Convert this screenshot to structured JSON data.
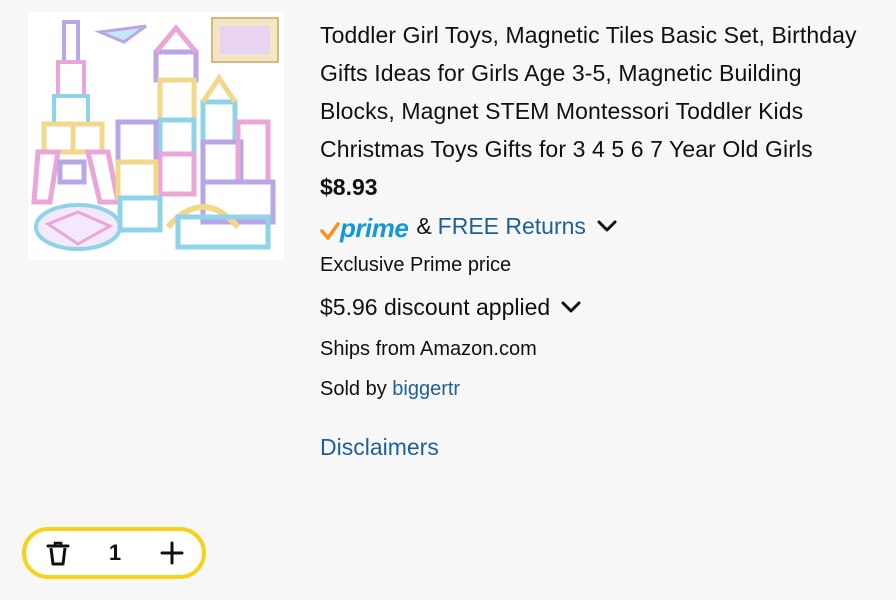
{
  "product": {
    "title": "Toddler Girl Toys, Magnetic Tiles Basic Set, Birthday Gifts Ideas for Girls Age 3-5, Magnetic Building Blocks, Magnet STEM Montessori Toddler Kids Christmas Toys Gifts for 3 4 5 6 7 Year Old Girls",
    "price": "$8.93",
    "prime_label": "prime",
    "amp": "&",
    "free_returns": "FREE Returns",
    "exclusive": "Exclusive Prime price",
    "discount": "$5.96 discount applied",
    "ships_from": "Ships from Amazon.com",
    "sold_by_prefix": "Sold by ",
    "seller": "biggertr",
    "disclaimers": "Disclaimers"
  },
  "quantity": {
    "value": "1"
  },
  "colors": {
    "link": "#1f5f99",
    "prime_blue": "#1399d6",
    "prime_check": "#ff8f1c",
    "highlight_border": "#f5d21b"
  },
  "icons": {
    "delete": "trash-icon",
    "add": "plus-icon",
    "expand": "chevron-down-icon"
  }
}
